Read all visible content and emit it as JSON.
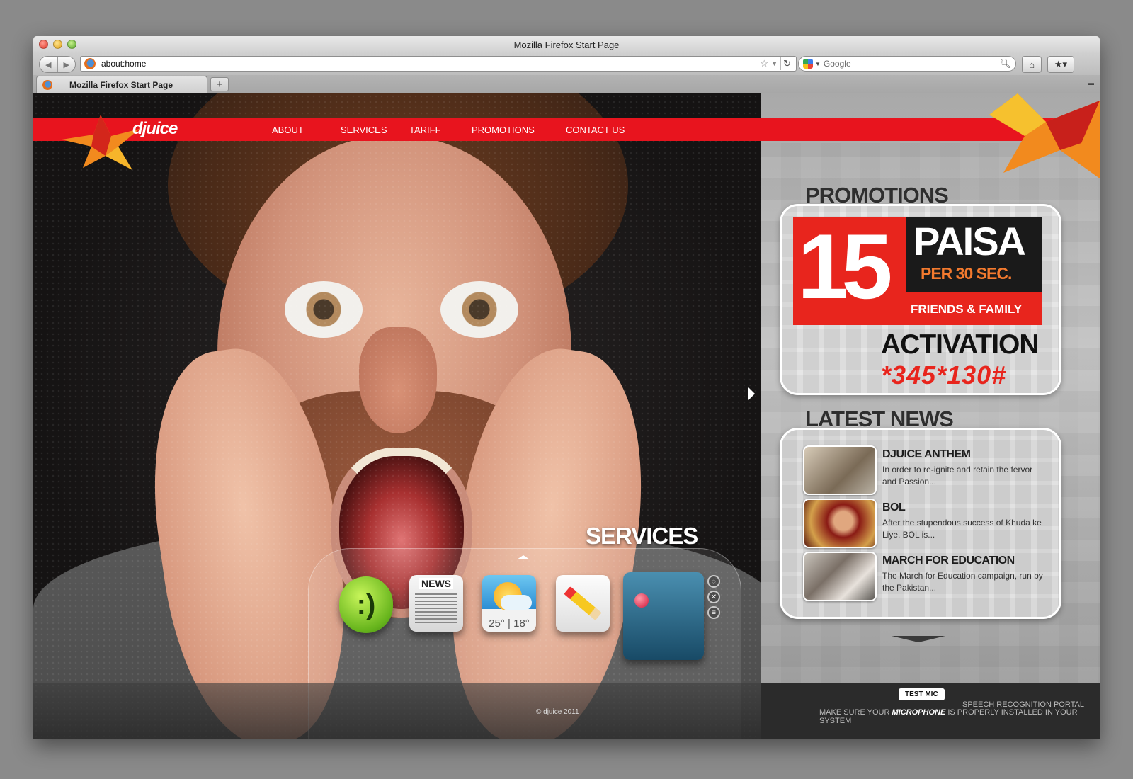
{
  "window": {
    "title": "Mozilla Firefox Start Page"
  },
  "toolbar": {
    "url": "about:home",
    "search_placeholder": "Google",
    "back_icon": "back-arrow-icon",
    "forward_icon": "forward-arrow-icon",
    "home_icon": "home-icon",
    "bookmarks_icon": "bookmarks-icon"
  },
  "tabs": [
    {
      "label": "Mozilla Firefox Start Page"
    }
  ],
  "site": {
    "brand": "djuice",
    "nav": [
      "ABOUT",
      "SERVICES",
      "TARIFF",
      "PROMOTIONS",
      "CONTACT US"
    ],
    "promotions_heading": "PROMOTIONS",
    "promo": {
      "big_number": "15",
      "paisa": "PAISA",
      "per": "PER 30 SEC.",
      "friends": "FRIENDS & FAMILY",
      "activation": "ACTIVATION",
      "code": "*345*130#"
    },
    "news_heading": "LATEST NEWS",
    "news": [
      {
        "title": "DJUICE ANTHEM",
        "text": "In order to re-ignite and retain the fervor and Passion..."
      },
      {
        "title": "BOL",
        "text": "After the stupendous success of Khuda ke Liye, BOL is..."
      },
      {
        "title": "MARCH FOR EDUCATION",
        "text": "The March for Education campaign, run by the Pakistan..."
      }
    ],
    "services_heading": "SERVICES",
    "services_apps": [
      {
        "name": "chat",
        "label": ":)"
      },
      {
        "name": "news",
        "label": "NEWS"
      },
      {
        "name": "weather",
        "label": "25° | 18°"
      },
      {
        "name": "notes",
        "label": ""
      },
      {
        "name": "map",
        "label": ""
      }
    ],
    "footer": {
      "copyright": "© djuice 2011",
      "test_mic": "TEST MIC",
      "portal": "SPEECH RECOGNITION PORTAL",
      "mic_pre": "MAKE SURE YOUR ",
      "mic_word": "MICROPHONE",
      "mic_post": " IS PROPERLY INSTALLED IN YOUR SYSTEM"
    }
  },
  "colors": {
    "brand_red": "#e8141e",
    "promo_orange": "#f37a2e",
    "sidebar_gray": "#b5b5b5"
  }
}
